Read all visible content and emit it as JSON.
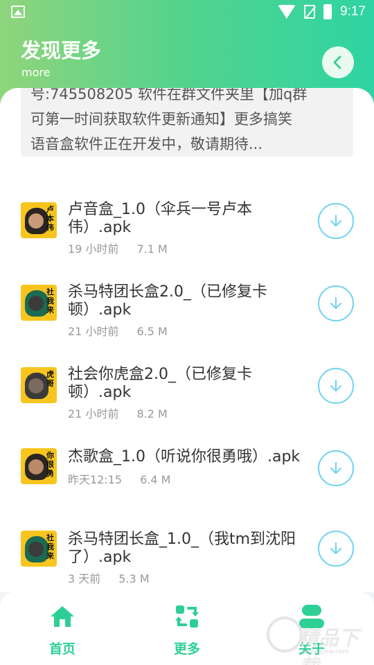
{
  "status_bar": {
    "time": "9:17"
  },
  "header": {
    "title": "发现更多",
    "subtitle": "more"
  },
  "notice": {
    "lines": [
      "号:745508205 软件在群文件夹里【加q群",
      "可第一时间获取软件更新通知】更多搞笑",
      "语音盒软件正在开发中，敬请期待..."
    ]
  },
  "files": [
    {
      "name_line1": "卢音盒_1.0（伞兵一号卢本",
      "name_line2": "伟）.apk",
      "time": "19 小时前",
      "size": "7.1 M",
      "thumb_text": "卢本伟"
    },
    {
      "name_line1": "杀马特团长盒2.0_（已修复卡",
      "name_line2": "顿）.apk",
      "time": "21 小时前",
      "size": "6.5 M",
      "thumb_text": "社我来"
    },
    {
      "name_line1": "社会你虎盒2.0_（已修复卡",
      "name_line2": "顿）.apk",
      "time": "21 小时前",
      "size": "8.2 M",
      "thumb_text": "虎哥"
    },
    {
      "name_line1": "杰歌盒_1.0（听说你很勇哦）.apk",
      "name_line2": "",
      "time": "昨天12:15",
      "size": "6.4 M",
      "thumb_text": "你很勇"
    },
    {
      "name_line1": "杀马特团长盒_1.0_（我tm到沈阳",
      "name_line2": "了）.apk",
      "time": "3 天前",
      "size": "5.3 M",
      "thumb_text": "社我来"
    }
  ],
  "tabbar": {
    "items": [
      {
        "label": "首页",
        "icon": "home-icon"
      },
      {
        "label": "更多",
        "icon": "refresh-swap-icon"
      },
      {
        "label": "关于",
        "icon": "user-icon"
      }
    ]
  },
  "watermark": {
    "text": "精品下载",
    "url": "www.jpxw.com"
  },
  "colors": {
    "accent": "#2ecf95",
    "download_ring": "#6fd3f0",
    "header_start": "#8fd57b",
    "header_end": "#2ed4a3"
  }
}
